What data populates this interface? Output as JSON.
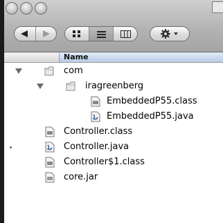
{
  "window": {
    "header": {
      "name_column": "Name"
    }
  },
  "toolbar": {
    "nav": {
      "back_icon": "back-arrow-icon",
      "forward_icon": "forward-arrow-icon"
    },
    "views": {
      "icon_view": "icon-view-icon",
      "list_view": "list-view-icon",
      "column_view": "column-view-icon",
      "selected": "list"
    },
    "action_icon": "gear-icon"
  },
  "files": [
    {
      "label": "com",
      "type": "folder",
      "expanded": true,
      "level": 0
    },
    {
      "label": "iragreenberg",
      "type": "folder",
      "expanded": true,
      "level": 1
    },
    {
      "label": "EmbeddedP55.class",
      "type": "class",
      "level": 2
    },
    {
      "label": "EmbeddedP55.java",
      "type": "java",
      "level": 2
    },
    {
      "label": "Controller.class",
      "type": "class",
      "level": 0
    },
    {
      "label": "Controller.java",
      "type": "java",
      "level": 0
    },
    {
      "label": "Controller$1.class",
      "type": "class",
      "level": 0
    },
    {
      "label": "core.jar",
      "type": "jar",
      "level": 0
    }
  ]
}
